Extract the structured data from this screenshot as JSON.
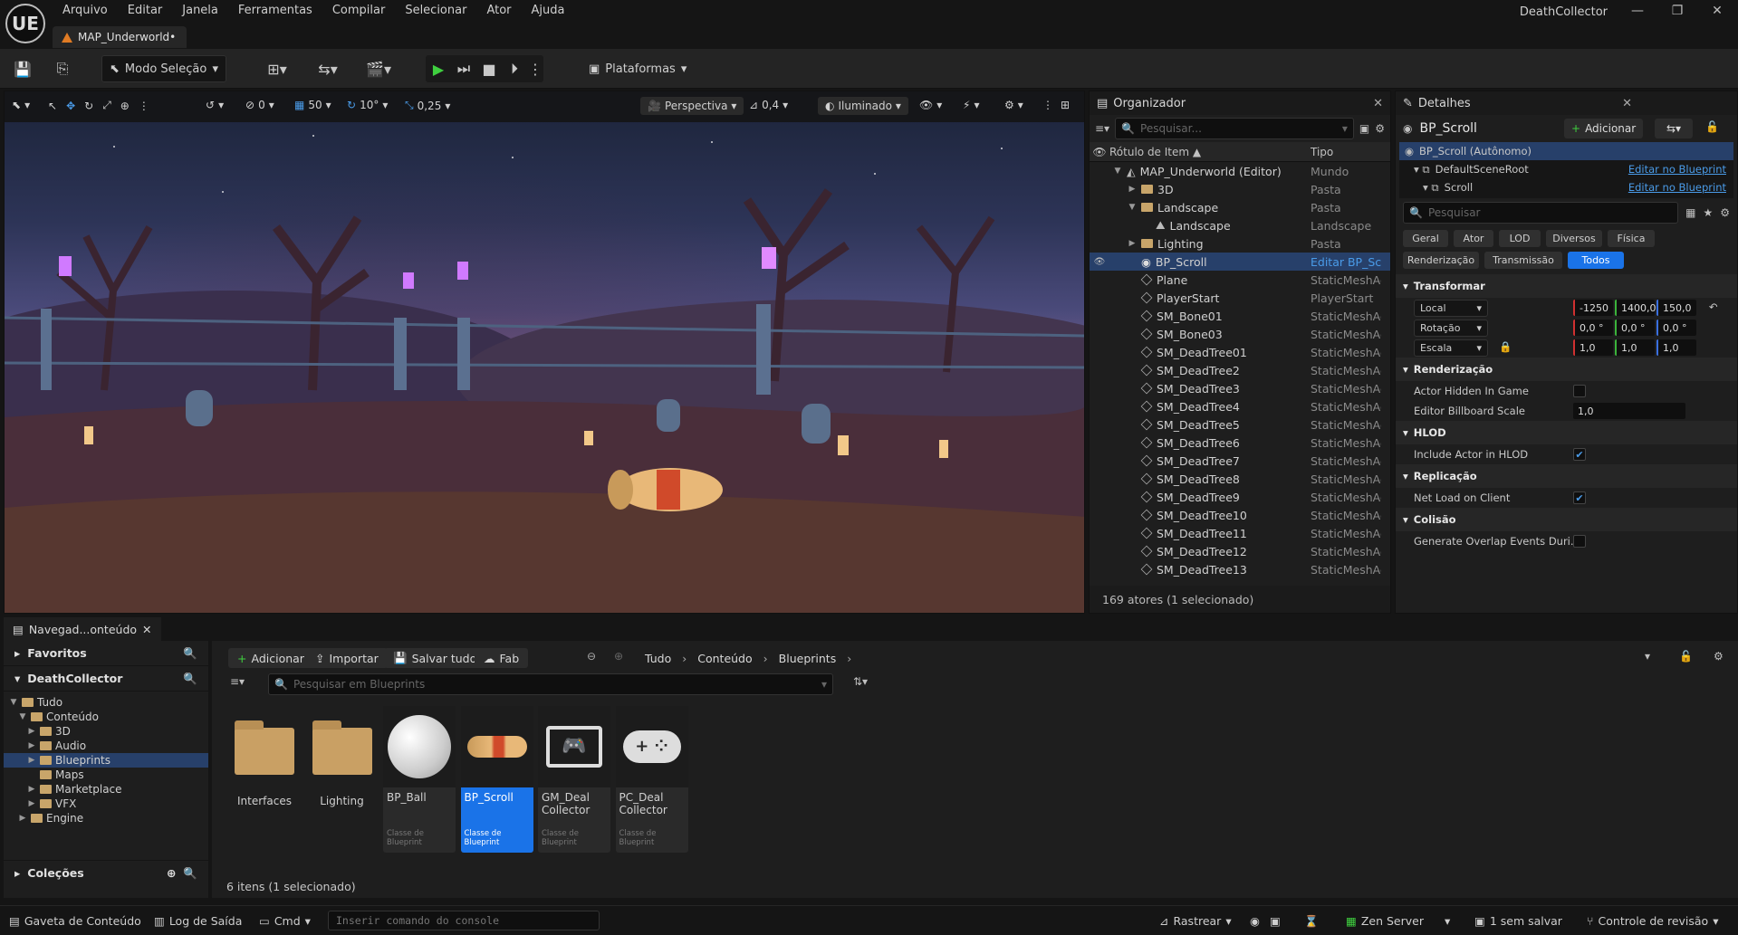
{
  "app": {
    "project_name": "DeathCollector",
    "logo": "UE",
    "map_tab": "MAP_Underworld•"
  },
  "menu": [
    "Arquivo",
    "Editar",
    "Janela",
    "Ferramentas",
    "Compilar",
    "Selecionar",
    "Ator",
    "Ajuda"
  ],
  "toolbar": {
    "mode": "Modo Seleção",
    "platforms": "Plataformas"
  },
  "viewport": {
    "rotate_snap": "0",
    "grid_snap": "50",
    "angle_snap": "10°",
    "scale_snap": "0,25",
    "view_mode": "Perspectiva",
    "camera_speed": "0,4",
    "lighting": "Iluminado"
  },
  "outliner": {
    "tab": "Organizador",
    "search_placeholder": "Pesquisar...",
    "col_label": "Rótulo de Item ▲",
    "col_type": "Tipo",
    "footer": "169 atores (1 selecionado)",
    "rows": [
      {
        "name": "MAP_Underworld (Editor)",
        "type": "Mundo",
        "indent": 0,
        "kind": "world",
        "expand": "▼"
      },
      {
        "name": "3D",
        "type": "Pasta",
        "indent": 1,
        "kind": "folder",
        "expand": "▶"
      },
      {
        "name": "Landscape",
        "type": "Pasta",
        "indent": 1,
        "kind": "folder",
        "expand": "▼"
      },
      {
        "name": "Landscape",
        "type": "Landscape",
        "indent": 2,
        "kind": "landscape",
        "expand": ""
      },
      {
        "name": "Lighting",
        "type": "Pasta",
        "indent": 1,
        "kind": "folder",
        "expand": "▶"
      },
      {
        "name": "BP_Scroll",
        "type": "Editar BP_Scroll",
        "indent": 1,
        "kind": "actor",
        "expand": "",
        "selected": true
      },
      {
        "name": "Plane",
        "type": "StaticMeshActor",
        "indent": 1,
        "kind": "mesh",
        "expand": ""
      },
      {
        "name": "PlayerStart",
        "type": "PlayerStart",
        "indent": 1,
        "kind": "mesh",
        "expand": ""
      },
      {
        "name": "SM_Bone01",
        "type": "StaticMeshActor",
        "indent": 1,
        "kind": "mesh",
        "expand": ""
      },
      {
        "name": "SM_Bone03",
        "type": "StaticMeshActor",
        "indent": 1,
        "kind": "mesh",
        "expand": ""
      },
      {
        "name": "SM_DeadTree01",
        "type": "StaticMeshActor",
        "indent": 1,
        "kind": "mesh",
        "expand": ""
      },
      {
        "name": "SM_DeadTree2",
        "type": "StaticMeshActor",
        "indent": 1,
        "kind": "mesh",
        "expand": ""
      },
      {
        "name": "SM_DeadTree3",
        "type": "StaticMeshActor",
        "indent": 1,
        "kind": "mesh",
        "expand": ""
      },
      {
        "name": "SM_DeadTree4",
        "type": "StaticMeshActor",
        "indent": 1,
        "kind": "mesh",
        "expand": ""
      },
      {
        "name": "SM_DeadTree5",
        "type": "StaticMeshActor",
        "indent": 1,
        "kind": "mesh",
        "expand": ""
      },
      {
        "name": "SM_DeadTree6",
        "type": "StaticMeshActor",
        "indent": 1,
        "kind": "mesh",
        "expand": ""
      },
      {
        "name": "SM_DeadTree7",
        "type": "StaticMeshActor",
        "indent": 1,
        "kind": "mesh",
        "expand": ""
      },
      {
        "name": "SM_DeadTree8",
        "type": "StaticMeshActor",
        "indent": 1,
        "kind": "mesh",
        "expand": ""
      },
      {
        "name": "SM_DeadTree9",
        "type": "StaticMeshActor",
        "indent": 1,
        "kind": "mesh",
        "expand": ""
      },
      {
        "name": "SM_DeadTree10",
        "type": "StaticMeshActor",
        "indent": 1,
        "kind": "mesh",
        "expand": ""
      },
      {
        "name": "SM_DeadTree11",
        "type": "StaticMeshActor",
        "indent": 1,
        "kind": "mesh",
        "expand": ""
      },
      {
        "name": "SM_DeadTree12",
        "type": "StaticMeshActor",
        "indent": 1,
        "kind": "mesh",
        "expand": ""
      },
      {
        "name": "SM_DeadTree13",
        "type": "StaticMeshActor",
        "indent": 1,
        "kind": "mesh",
        "expand": ""
      }
    ]
  },
  "details": {
    "tab": "Detalhes",
    "actor_name": "BP_Scroll",
    "add_label": "Adicionar",
    "components": [
      {
        "name": "BP_Scroll (Autônomo)",
        "link": ""
      },
      {
        "name": "DefaultSceneRoot",
        "link": "Editar no Blueprint"
      },
      {
        "name": "Scroll",
        "link": "Editar no Blueprint"
      }
    ],
    "search_placeholder": "Pesquisar",
    "filters_row1": [
      "Geral",
      "Ator",
      "LOD",
      "Diversos",
      "Física"
    ],
    "filters_row2": [
      "Renderização",
      "Transmissão",
      "Todos"
    ],
    "sections": {
      "transform": "Transformar",
      "rendering": "Renderização",
      "hlod": "HLOD",
      "replication": "Replicação",
      "collision": "Colisão"
    },
    "transform": {
      "location_label": "Local",
      "rotation_label": "Rotação",
      "scale_label": "Escala",
      "location": [
        "-1250",
        "1400,0",
        "150,0"
      ],
      "rotation": [
        "0,0 °",
        "0,0 °",
        "0,0 °"
      ],
      "scale": [
        "1,0",
        "1,0",
        "1,0"
      ]
    },
    "props": {
      "actor_hidden": "Actor Hidden In Game",
      "billboard_scale": "Editor Billboard Scale",
      "billboard_value": "1,0",
      "include_hlod": "Include Actor in HLOD",
      "net_load": "Net Load on Client",
      "overlap": "Generate Overlap Events Duri..."
    }
  },
  "content_browser": {
    "tab": "Navegad...onteúdo",
    "favorites": "Favoritos",
    "project": "DeathCollector",
    "collections": "Coleções",
    "tree": [
      {
        "name": "Tudo",
        "indent": 0,
        "expand": "▼"
      },
      {
        "name": "Conteúdo",
        "indent": 1,
        "expand": "▼"
      },
      {
        "name": "3D",
        "indent": 2,
        "expand": "▶"
      },
      {
        "name": "Audio",
        "indent": 2,
        "expand": "▶"
      },
      {
        "name": "Blueprints",
        "indent": 2,
        "expand": "▶",
        "selected": true
      },
      {
        "name": "Maps",
        "indent": 2,
        "expand": ""
      },
      {
        "name": "Marketplace",
        "indent": 2,
        "expand": "▶"
      },
      {
        "name": "VFX",
        "indent": 2,
        "expand": "▶"
      },
      {
        "name": "Engine",
        "indent": 1,
        "expand": "▶"
      }
    ],
    "buttons": {
      "add": "Adicionar",
      "import": "Importar",
      "save_all": "Salvar tudo",
      "fab": "Fab"
    },
    "breadcrumb": [
      "Tudo",
      "Conteúdo",
      "Blueprints"
    ],
    "search_placeholder": "Pesquisar em Blueprints",
    "assets": [
      {
        "name": "Interfaces",
        "kind": "folder",
        "class": ""
      },
      {
        "name": "Lighting",
        "kind": "folder",
        "class": ""
      },
      {
        "name": "BP_Ball",
        "kind": "ball",
        "class": "Classe de Blueprint"
      },
      {
        "name": "BP_Scroll",
        "kind": "scroll",
        "class": "Classe de Blueprint",
        "selected": true
      },
      {
        "name": "GM_Deal Collector",
        "kind": "monitor",
        "class": "Classe de Blueprint"
      },
      {
        "name": "PC_Deal Collector",
        "kind": "gamepad",
        "class": "Classe de Blueprint"
      }
    ],
    "footer": "6 itens (1 selecionado)"
  },
  "statusbar": {
    "content_drawer": "Gaveta de Conteúdo",
    "output_log": "Log de Saída",
    "cmd": "Cmd",
    "console_placeholder": "Inserir comando do console",
    "trace": "Rastrear",
    "zen": "Zen Server",
    "unsaved": "1 sem salvar",
    "revision": "Controle de revisão"
  },
  "colors": {
    "accent": "#1a73e8",
    "selection": "#27406a",
    "link": "#4a9be8",
    "play": "#3fcf3f",
    "folder": "#c9a064"
  }
}
